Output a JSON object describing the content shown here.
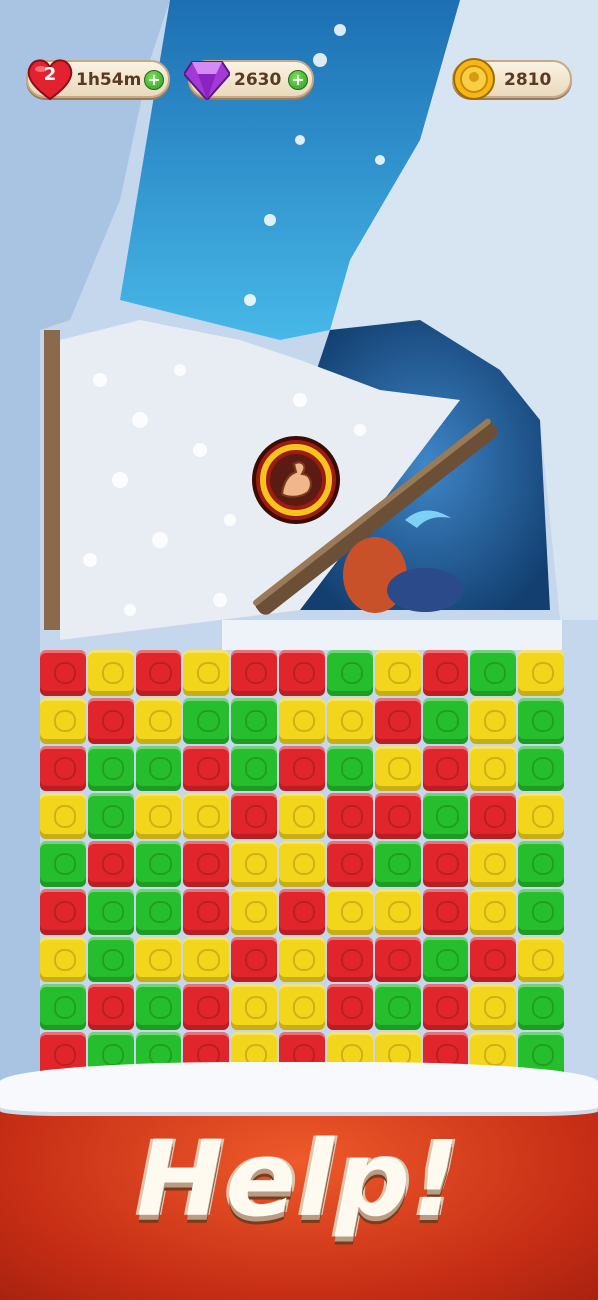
{
  "hud": {
    "lives": {
      "count": "2",
      "timer": "1h54m",
      "icon": "heart-icon",
      "plus": "+"
    },
    "gems": {
      "count": "2630",
      "icon": "gem-icon",
      "plus": "+"
    },
    "coins": {
      "count": "2810",
      "icon": "coin-icon"
    }
  },
  "booster": {
    "icon": "flexed-arm-icon"
  },
  "banner": {
    "text": "Help!"
  },
  "board": {
    "columns": 11,
    "rows": [
      [
        "red",
        "yellow",
        "red",
        "yellow",
        "red",
        "red",
        "green",
        "yellow",
        "red",
        "green",
        "yellow"
      ],
      [
        "yellow",
        "red",
        "yellow",
        "green",
        "green",
        "yellow",
        "yellow",
        "red",
        "green",
        "yellow",
        "green"
      ],
      [
        "red",
        "green",
        "green",
        "red",
        "green",
        "red",
        "green",
        "yellow",
        "red",
        "yellow",
        "green"
      ],
      [
        "yellow",
        "green",
        "yellow",
        "yellow",
        "red",
        "yellow",
        "red",
        "red",
        "green",
        "red",
        "yellow"
      ],
      [
        "green",
        "red",
        "green",
        "red",
        "yellow",
        "yellow",
        "red",
        "green",
        "red",
        "yellow",
        "green"
      ],
      [
        "red",
        "green",
        "green",
        "red",
        "yellow",
        "red",
        "yellow",
        "yellow",
        "red",
        "yellow",
        "green"
      ],
      [
        "yellow",
        "green",
        "yellow",
        "yellow",
        "red",
        "yellow",
        "red",
        "red",
        "green",
        "red",
        "yellow"
      ],
      [
        "green",
        "red",
        "green",
        "red",
        "yellow",
        "yellow",
        "red",
        "green",
        "red",
        "yellow",
        "green"
      ],
      [
        "red",
        "green",
        "green",
        "red",
        "yellow",
        "red",
        "yellow",
        "yellow",
        "red",
        "yellow",
        "green"
      ]
    ]
  },
  "colors": {
    "red": "#e0262a",
    "yellow": "#f3d51b",
    "green": "#27be2d",
    "banner": "#d23b1c"
  }
}
